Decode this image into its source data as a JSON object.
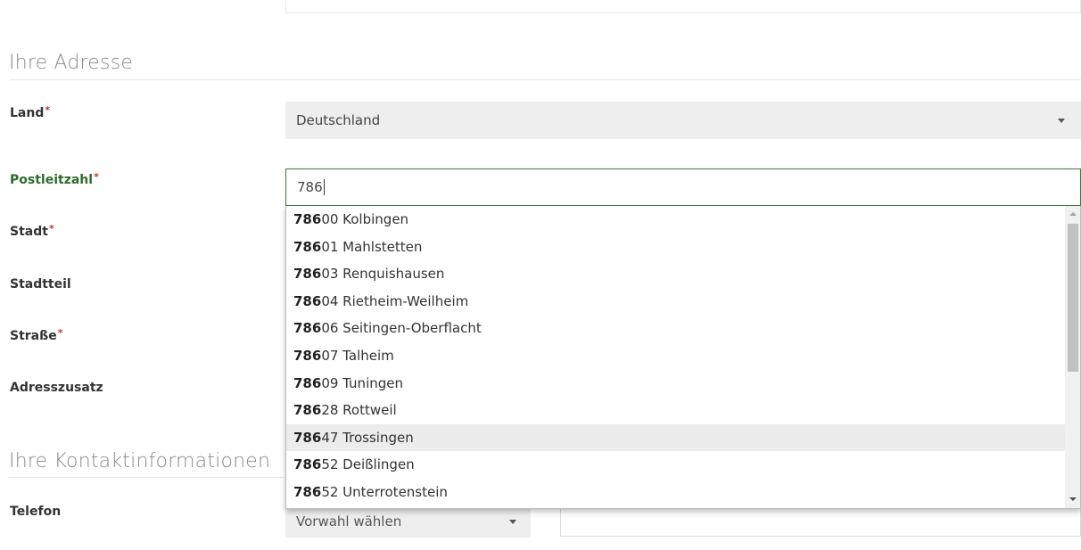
{
  "address_section": {
    "title": "Ihre Adresse",
    "fields": {
      "country": {
        "label": "Land",
        "value": "Deutschland",
        "required": "*"
      },
      "postal_code": {
        "label": "Postleitzahl",
        "value": "786",
        "required": "*"
      },
      "city": {
        "label": "Stadt",
        "required": "*"
      },
      "district": {
        "label": "Stadtteil"
      },
      "street": {
        "label": "Straße",
        "required": "*"
      },
      "address_extra": {
        "label": "Adresszusatz"
      }
    }
  },
  "autocomplete": {
    "query": "786",
    "hovered_index": 8,
    "options": [
      {
        "match": "786",
        "rest": "00 Kolbingen"
      },
      {
        "match": "786",
        "rest": "01 Mahlstetten"
      },
      {
        "match": "786",
        "rest": "03 Renquishausen"
      },
      {
        "match": "786",
        "rest": "04 Rietheim-Weilheim"
      },
      {
        "match": "786",
        "rest": "06 Seitingen-Oberflacht"
      },
      {
        "match": "786",
        "rest": "07 Talheim"
      },
      {
        "match": "786",
        "rest": "09 Tuningen"
      },
      {
        "match": "786",
        "rest": "28 Rottweil"
      },
      {
        "match": "786",
        "rest": "47 Trossingen"
      },
      {
        "match": "786",
        "rest": "52 Deißlingen"
      },
      {
        "match": "786",
        "rest": "52 Unterrotenstein"
      }
    ]
  },
  "contact_section": {
    "title": "Ihre Kontaktinformationen",
    "fields": {
      "phone": {
        "label": "Telefon",
        "prefix_placeholder": "Vorwahl wählen"
      }
    }
  },
  "colors": {
    "accent_green": "#3c7a3a",
    "required_red": "#c0392b",
    "hover_bg": "#ececec"
  }
}
